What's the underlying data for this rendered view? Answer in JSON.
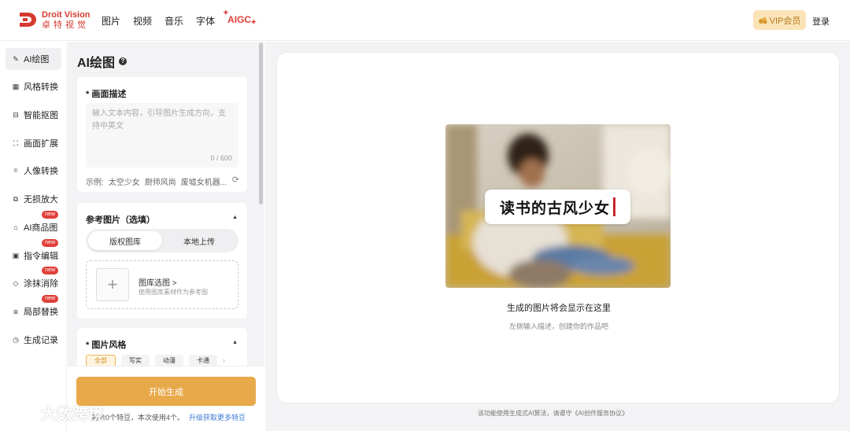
{
  "brand": {
    "name_en": "Droit Vision",
    "name_cn": "卓特视觉",
    "color": "#d43a2f"
  },
  "nav": [
    {
      "label": "图片"
    },
    {
      "label": "视频"
    },
    {
      "label": "音乐"
    },
    {
      "label": "字体"
    },
    {
      "label": "AIGC"
    }
  ],
  "header": {
    "vip_label": "VIP会员",
    "login_label": "登录"
  },
  "sidebar": {
    "items": [
      {
        "label": "AI绘图",
        "icon": "magic-wand-icon",
        "active": true,
        "badge": ""
      },
      {
        "label": "风格转换",
        "icon": "grid-icon",
        "active": false,
        "badge": ""
      },
      {
        "label": "智能抠图",
        "icon": "cutout-icon",
        "active": false,
        "badge": ""
      },
      {
        "label": "画面扩展",
        "icon": "expand-icon",
        "active": false,
        "badge": ""
      },
      {
        "label": "人像转换",
        "icon": "portrait-icon",
        "active": false,
        "badge": ""
      },
      {
        "label": "无损放大",
        "icon": "enlarge-icon",
        "active": false,
        "badge": ""
      },
      {
        "label": "AI商品图",
        "icon": "product-icon",
        "active": false,
        "badge": "new"
      },
      {
        "label": "指令编辑",
        "icon": "edit-icon",
        "active": false,
        "badge": "new"
      },
      {
        "label": "涂抹消除",
        "icon": "eraser-icon",
        "active": false,
        "badge": "new"
      },
      {
        "label": "局部替换",
        "icon": "replace-icon",
        "active": false,
        "badge": "new"
      },
      {
        "label": "生成记录",
        "icon": "history-icon",
        "active": false,
        "badge": ""
      }
    ]
  },
  "panel": {
    "title": "AI绘图",
    "description": {
      "label": "画面描述",
      "required_mark": "*",
      "placeholder": "输入文本内容，引导图片生成方向，支持中英文",
      "counter": "0 / 600",
      "examples_prefix": "示例:",
      "examples": [
        "太空少女",
        "厨师风尚",
        "废墟女机器..."
      ]
    },
    "reference": {
      "label": "参考图片（选填）",
      "tabs": [
        "版权图库",
        "本地上传"
      ],
      "upload_title": "图库选图 >",
      "upload_sub": "使用图库素材作为参考图"
    },
    "style": {
      "label": "图片风格",
      "required_mark": "*",
      "chips": [
        "全部",
        "写实",
        "动漫",
        "卡通"
      ]
    },
    "generate_label": "开始生成",
    "bean_note": "剩余0个特豆，本次使用4个。",
    "upgrade_link": "升级获取更多特豆"
  },
  "canvas": {
    "preview_caption": "读书的古风少女",
    "title": "生成的图片将会显示在这里",
    "subtitle": "左侧输入描述，创建你的作品吧",
    "footer": "该功能使用生成式AI算法，请遵守《AI创作服务协议》"
  },
  "watermark": "大数跨境",
  "colors": {
    "accent": "#e8a94b",
    "badge": "#e0403a",
    "link": "#3a7bd5"
  }
}
